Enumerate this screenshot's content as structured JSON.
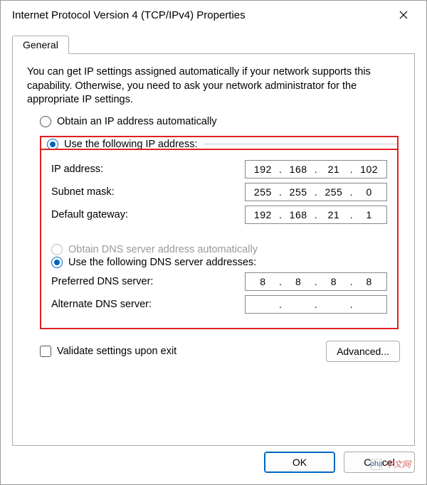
{
  "window": {
    "title": "Internet Protocol Version 4 (TCP/IPv4) Properties"
  },
  "tabs": {
    "general": "General"
  },
  "description": "You can get IP settings assigned automatically if your network supports this capability. Otherwise, you need to ask your network administrator for the appropriate IP settings.",
  "ip_section": {
    "auto_label": "Obtain an IP address automatically",
    "manual_label": "Use the following IP address:",
    "selected": "manual",
    "ip_address_label": "IP address:",
    "ip_address": [
      "192",
      "168",
      "21",
      "102"
    ],
    "subnet_label": "Subnet mask:",
    "subnet": [
      "255",
      "255",
      "255",
      "0"
    ],
    "gateway_label": "Default gateway:",
    "gateway": [
      "192",
      "168",
      "21",
      "1"
    ]
  },
  "dns_section": {
    "auto_label": "Obtain DNS server address automatically",
    "auto_enabled": false,
    "manual_label": "Use the following DNS server addresses:",
    "selected": "manual",
    "preferred_label": "Preferred DNS server:",
    "preferred": [
      "8",
      "8",
      "8",
      "8"
    ],
    "alternate_label": "Alternate DNS server:",
    "alternate": [
      "",
      "",
      "",
      ""
    ]
  },
  "validate_label": "Validate settings upon exit",
  "validate_checked": false,
  "buttons": {
    "advanced": "Advanced...",
    "ok": "OK",
    "cancel": "Cancel"
  },
  "watermark": {
    "logo": "php",
    "text": "中文网"
  }
}
